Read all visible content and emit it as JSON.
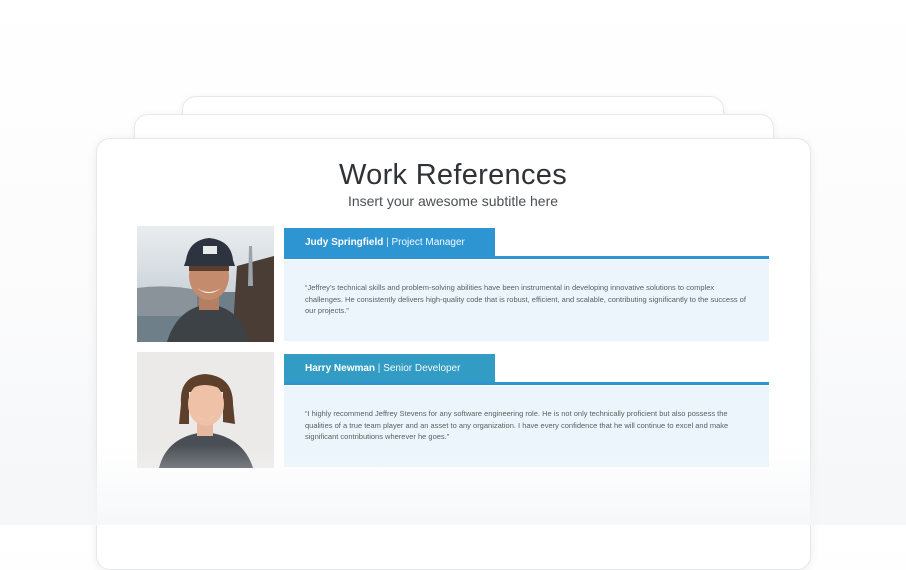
{
  "header": {
    "title": "Work References",
    "subtitle": "Insert your awesome subtitle here"
  },
  "references": [
    {
      "name": "Judy Springfield",
      "separator": " | ",
      "role": "Project Manager",
      "quote": "“Jeffrey’s technical skills and problem-solving abilities have been instrumental in developing innovative solutions to complex challenges. He consistently delivers high-quality code that is robust, efficient, and scalable, contributing significantly to the success of our projects.”",
      "accent": "#2e95d3"
    },
    {
      "name": "Harry Newman",
      "separator": " | ",
      "role": "Senior Developer",
      "quote": "“I highly recommend Jeffrey Stevens for any software engineering role. He is not only technically proficient but also possess the qualities of a true team player and an asset to any organization. I have every confidence that he will continue to excel and make significant contributions wherever he goes.”",
      "accent": "#329cc4"
    }
  ],
  "colors": {
    "title": "#2f3337",
    "quote_bg": "#ebf5fb"
  }
}
